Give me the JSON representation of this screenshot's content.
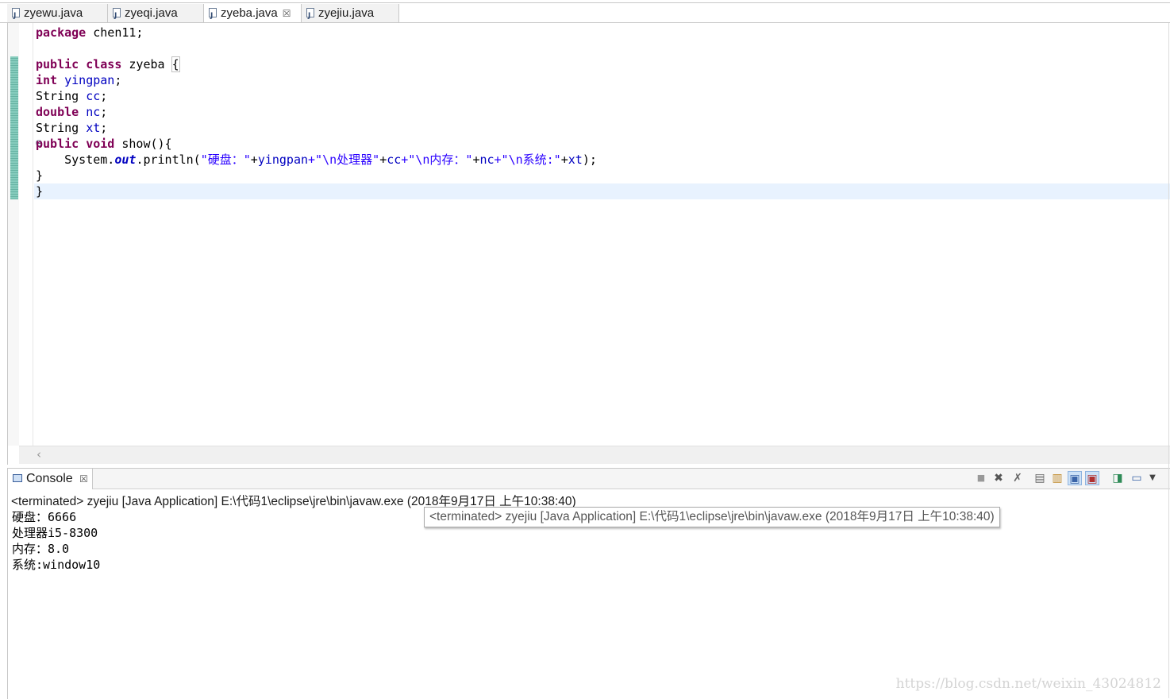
{
  "editor_tabs": [
    {
      "label": "zyewu.java",
      "active": false
    },
    {
      "label": "zyeqi.java",
      "active": false
    },
    {
      "label": "zyeba.java",
      "active": true
    },
    {
      "label": "zyejiu.java",
      "active": false
    }
  ],
  "tab_close_glyph": "☒",
  "code": {
    "line_package_kw": "package",
    "line_package_rest": " chen11;",
    "line_class_kw1": "public",
    "line_class_kw2": "class",
    "line_class_rest": " zyeba ",
    "line_class_brace": "{",
    "field1_kw": "int",
    "field1_name": "yingpan",
    "field2_type": "String",
    "field2_name": "cc",
    "field3_kw": "double",
    "field3_name": "nc",
    "field4_type": "String",
    "field4_name": "xt",
    "method_kw1": "public",
    "method_kw2": "void",
    "method_rest": " show(){",
    "println_prefix": "System.",
    "println_out": "out",
    "println_call": ".println(",
    "str1": "\"硬盘：\"",
    "plus_yingpan": "+",
    "f_yingpan": "yingpan",
    "str2": "+\"\\n处理器\"",
    "plus_cc": "+",
    "f_cc": "cc",
    "str3": "+\"\\n内存：\"",
    "plus_nc": "+",
    "f_nc": "nc",
    "str4": "+\"\\n系统:\"",
    "plus_xt": "+",
    "f_xt": "xt",
    "println_end": ");",
    "close_method": "}",
    "close_class": "}"
  },
  "console": {
    "tab_label": "Console",
    "close_glyph": "☒",
    "terminated_line": "<terminated> zyejiu [Java Application] E:\\代码1\\eclipse\\jre\\bin\\javaw.exe (2018年9月17日 上午10:38:40)",
    "tooltip": "<terminated> zyejiu [Java Application] E:\\代码1\\eclipse\\jre\\bin\\javaw.exe (2018年9月17日 上午10:38:40)",
    "output": [
      "硬盘：6666",
      "处理器i5-8300",
      "内存：8.0",
      "系统:window10"
    ]
  },
  "toolbar_icons": [
    "terminate-icon",
    "remove-launch-icon",
    "remove-all-icon",
    "clear-console-icon",
    "scroll-lock-icon",
    "show-stdout-icon",
    "show-stderr-icon",
    "pin-console-icon",
    "open-console-icon",
    "view-menu-icon"
  ],
  "watermark": "https://blog.csdn.net/weixin_43024812"
}
